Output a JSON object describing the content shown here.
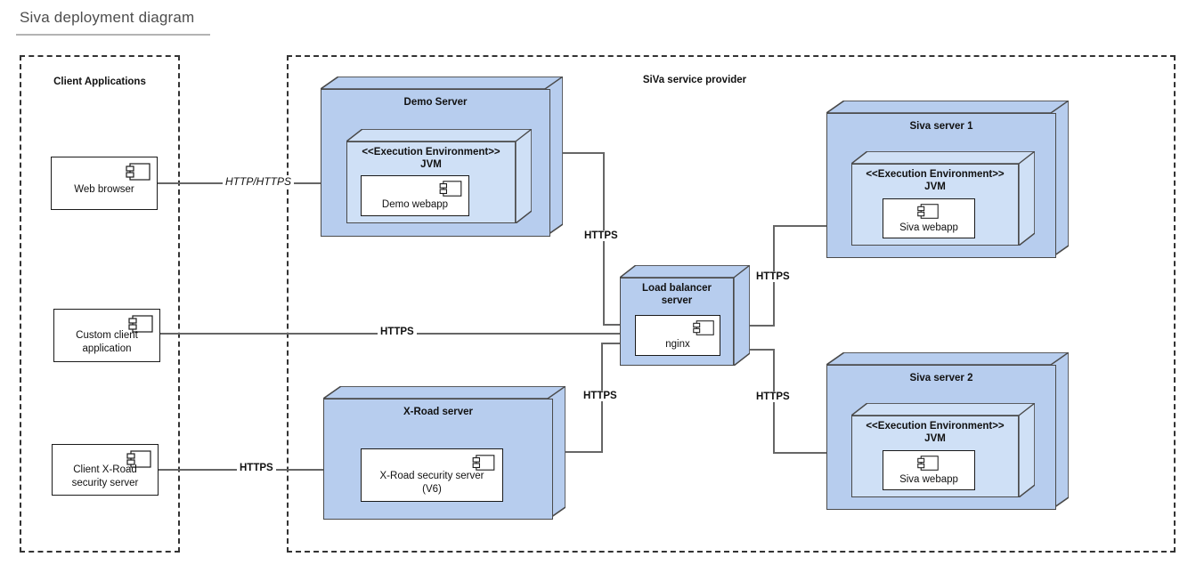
{
  "page": {
    "title": "Siva deployment diagram"
  },
  "boundaries": [
    {
      "name": "client-applications",
      "label": "Client Applications"
    },
    {
      "name": "siva-service-provider",
      "label": "SiVa service provider"
    }
  ],
  "clients": [
    {
      "name": "web-browser",
      "label": "Web browser"
    },
    {
      "name": "custom-client-application",
      "label": "Custom client\napplication",
      "line1": "Custom client",
      "line2": "application"
    },
    {
      "name": "client-xroad-security-server",
      "label": "Client X-Road\nsecurity server",
      "line1": "Client X-Road",
      "line2": "security server"
    }
  ],
  "nodes": {
    "demo_server": {
      "label": "Demo Server",
      "jvm": {
        "stereotype": "<<Execution Environment>>",
        "label": "JVM"
      },
      "component": {
        "label": "Demo webapp"
      }
    },
    "xroad_server": {
      "label": "X-Road server",
      "component": {
        "line1": "X-Road security server",
        "line2": "(V6)"
      }
    },
    "load_balancer": {
      "line1": "Load balancer",
      "line2": "server",
      "component": {
        "label": "nginx"
      }
    },
    "siva_server_1": {
      "label": "Siva server 1",
      "jvm": {
        "stereotype": "<<Execution Environment>>",
        "label": "JVM"
      },
      "component": {
        "label": "Siva webapp"
      }
    },
    "siva_server_2": {
      "label": "Siva server 2",
      "jvm": {
        "stereotype": "<<Execution Environment>>",
        "label": "JVM"
      },
      "component": {
        "label": "Siva webapp"
      }
    }
  },
  "edges": [
    {
      "name": "edge-browser-to-demo",
      "label": "HTTP/HTTPS",
      "style": "italic"
    },
    {
      "name": "edge-custom-client-to-nginx",
      "label": "HTTPS",
      "style": "bold"
    },
    {
      "name": "edge-xroad-client-to-xroad-server",
      "label": "HTTPS",
      "style": "bold"
    },
    {
      "name": "edge-demo-to-nginx",
      "label": "HTTPS",
      "style": "bold"
    },
    {
      "name": "edge-xroad-server-to-nginx",
      "label": "HTTPS",
      "style": "bold"
    },
    {
      "name": "edge-nginx-to-siva1",
      "label": "HTTPS",
      "style": "bold"
    },
    {
      "name": "edge-nginx-to-siva2",
      "label": "HTTPS",
      "style": "bold"
    }
  ],
  "colors": {
    "node_fill": "#b7cdee",
    "node_inner_fill": "#cfe0f6",
    "node_stroke": "#4a4a4a",
    "line": "#666666",
    "boundary": "#333333",
    "title": "#4d4d4d"
  }
}
